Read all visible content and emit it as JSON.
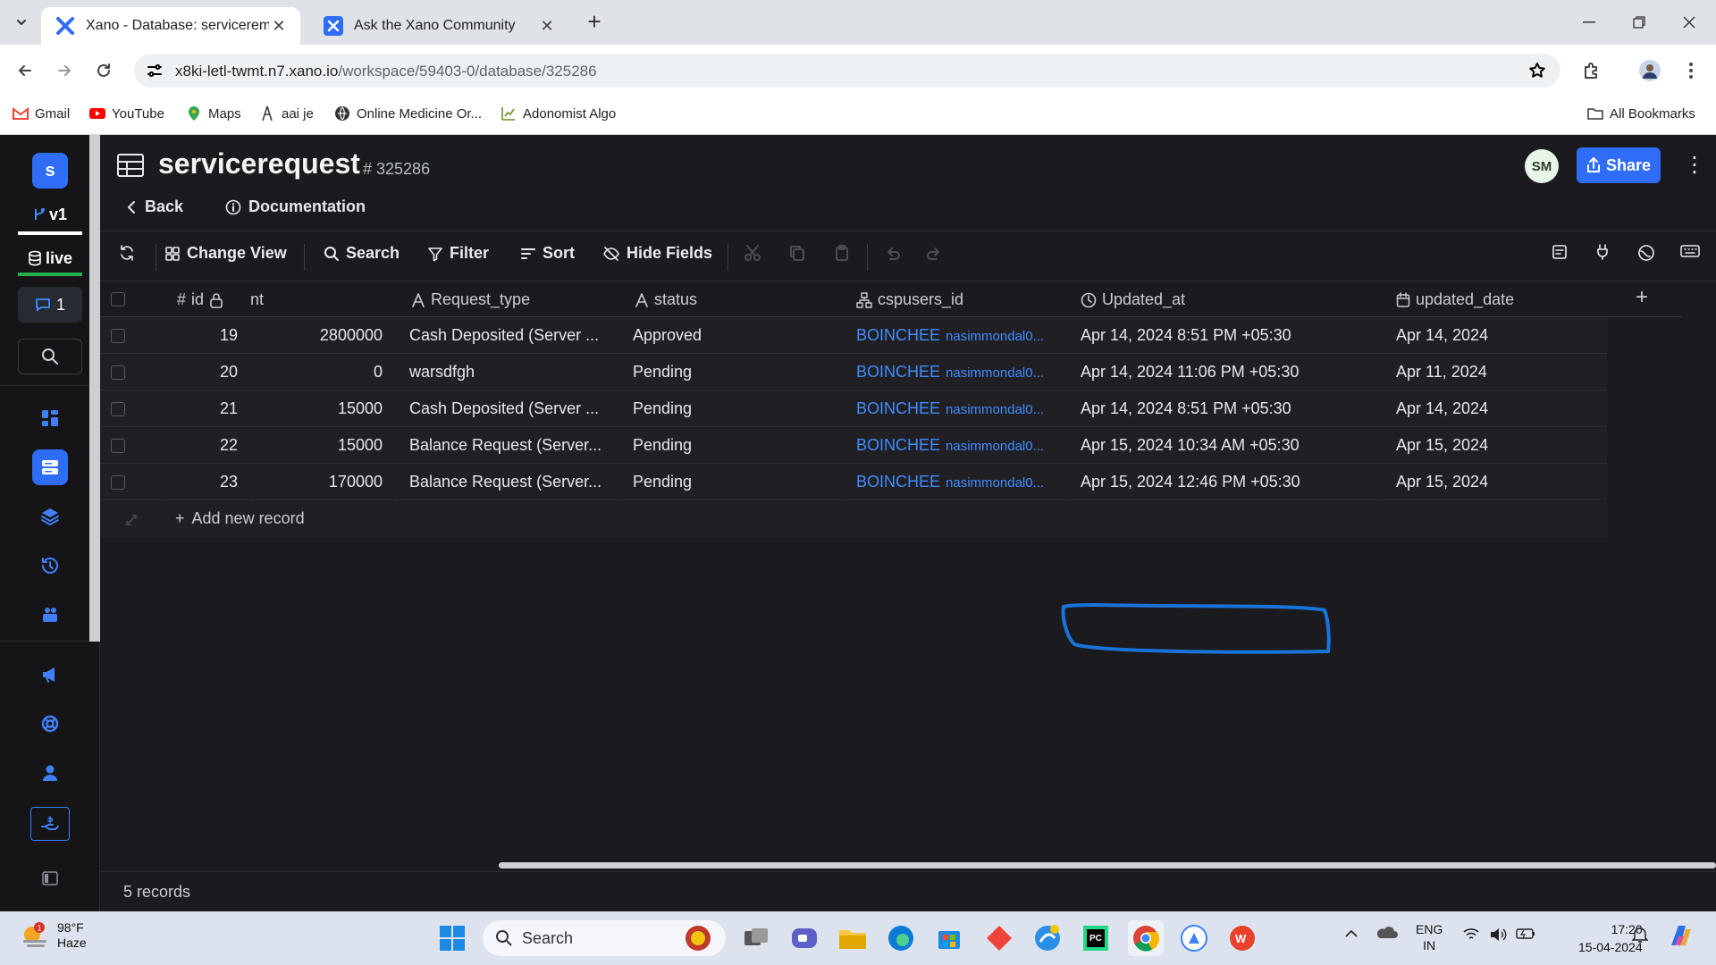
{
  "browser": {
    "tabs": [
      {
        "title": "Xano - Database: serviceremques",
        "active": true
      },
      {
        "title": "Ask the Xano Community",
        "active": false
      }
    ],
    "url_host": "x8ki-letl-twmt.n7.xano.io",
    "url_path": "/workspace/59403-0/database/325286",
    "bookmarks": [
      "Gmail",
      "YouTube",
      "Maps",
      "aai je",
      "Online Medicine Or...",
      "Adonomist Algo"
    ],
    "all_bookmarks": "All Bookmarks"
  },
  "rail": {
    "workspace_initial": "s",
    "version": "v1",
    "env": "live",
    "comments_count": "1"
  },
  "header": {
    "table_name": "servicerequest",
    "table_id": "# 325286",
    "back_label": "Back",
    "doc_label": "Documentation",
    "avatar_initials": "SM",
    "share_label": "Share"
  },
  "toolbar": {
    "change_view": "Change View",
    "search": "Search",
    "filter": "Filter",
    "sort": "Sort",
    "hide_fields": "Hide Fields"
  },
  "columns": [
    "id",
    "nt",
    "Request_type",
    "status",
    "cspusers_id",
    "Updated_at",
    "updated_date"
  ],
  "rows": [
    {
      "id": "19",
      "nt": "2800000",
      "request_type": "Cash Deposited (Server ...",
      "status": "Approved",
      "user": "BOINCHEE",
      "user_sub": "nasimmondal0...",
      "updated_at": "Apr 14, 2024 8:51 PM +05:30",
      "updated_date": "Apr 14, 2024"
    },
    {
      "id": "20",
      "nt": "0",
      "request_type": "warsdfgh",
      "status": "Pending",
      "user": "BOINCHEE",
      "user_sub": "nasimmondal0...",
      "updated_at": "Apr 14, 2024 11:06 PM +05:30",
      "updated_date": "Apr 11, 2024"
    },
    {
      "id": "21",
      "nt": "15000",
      "request_type": "Cash Deposited (Server ...",
      "status": "Pending",
      "user": "BOINCHEE",
      "user_sub": "nasimmondal0...",
      "updated_at": "Apr 14, 2024 8:51 PM +05:30",
      "updated_date": "Apr 14, 2024"
    },
    {
      "id": "22",
      "nt": "15000",
      "request_type": "Balance Request (Server...",
      "status": "Pending",
      "user": "BOINCHEE",
      "user_sub": "nasimmondal0...",
      "updated_at": "Apr 15, 2024 10:34 AM +05:30",
      "updated_date": "Apr 15, 2024"
    },
    {
      "id": "23",
      "nt": "170000",
      "request_type": "Balance Request (Server...",
      "status": "Pending",
      "user": "BOINCHEE",
      "user_sub": "nasimmondal0...",
      "updated_at": "Apr 15, 2024 12:46 PM +05:30",
      "updated_date": "Apr 15, 2024"
    }
  ],
  "add_record_label": "Add new record",
  "records_count": "5 records",
  "annotation_color": "#1a73d9",
  "taskbar": {
    "temp": "98°F",
    "weather": "Haze",
    "weather_badge": "1",
    "search": "Search",
    "lang_1": "ENG",
    "lang_2": "IN",
    "time": "17:20",
    "date": "15-04-2024"
  },
  "colors": {
    "accent": "#2f6df6",
    "link": "#3f8cff",
    "live": "#22b14c"
  }
}
